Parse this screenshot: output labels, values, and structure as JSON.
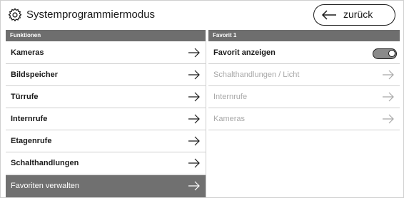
{
  "header": {
    "title": "Systemprogrammiermodus",
    "back_label": "zurück"
  },
  "left_panel": {
    "section_title": "Funktionen",
    "items": [
      {
        "label": "Kameras"
      },
      {
        "label": "Bildspeicher"
      },
      {
        "label": "Türrufe"
      },
      {
        "label": "Internrufe"
      },
      {
        "label": "Etagenrufe"
      },
      {
        "label": "Schalthandlungen"
      },
      {
        "label": "Favoriten verwalten",
        "selected": true
      }
    ]
  },
  "right_panel": {
    "section_title": "Favorit 1",
    "toggle_label": "Favorit anzeigen",
    "toggle_on": false,
    "items": [
      {
        "label": "Schalthandlungen / Licht",
        "enabled": false
      },
      {
        "label": "Internrufe",
        "enabled": false
      },
      {
        "label": "Kameras",
        "enabled": false
      }
    ]
  },
  "colors": {
    "section_header_bg": "#6e6e6e",
    "selected_row_bg": "#707070",
    "disabled_text": "#a8a8a8"
  }
}
